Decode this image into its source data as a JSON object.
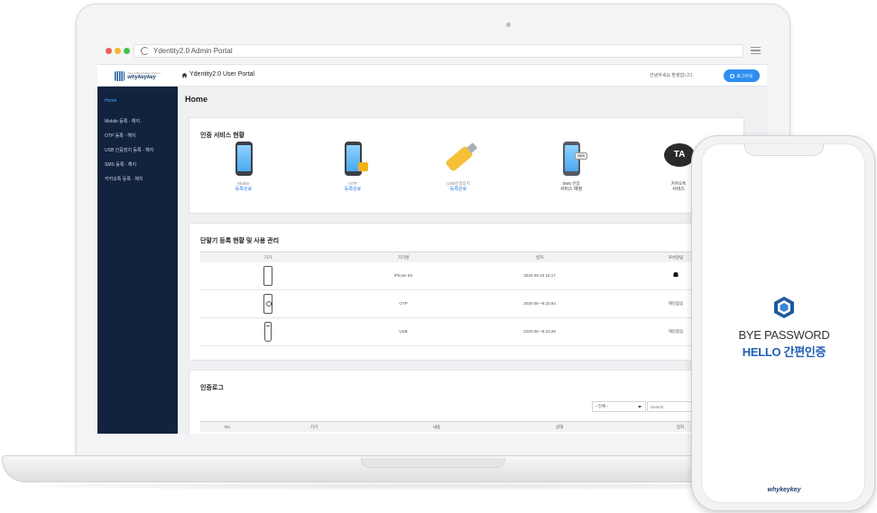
{
  "browser": {
    "address": "Ydentity2.0 Admin Portal"
  },
  "header": {
    "logo_sub": "Your Authentication Partner",
    "logo_main": "whykeykey",
    "title": "Ydentity2.0 User Portal",
    "welcome": "안녕하세요 환영합니다.",
    "logout_label": "로그아웃"
  },
  "sidebar": {
    "items": [
      {
        "label": "Home"
      },
      {
        "label": "Mobile 등록 · 해지"
      },
      {
        "label": "OTP 등록 · 해지"
      },
      {
        "label": "USB 인증장치 등록 · 해지"
      },
      {
        "label": "SMS 등록 · 해지"
      },
      {
        "label": "카카오톡 등록 · 해지"
      }
    ]
  },
  "main": {
    "page_title": "Home",
    "services": {
      "title": "인증 서비스 현황",
      "items": [
        {
          "label": "Mobile",
          "status": "등록완료",
          "icon": "mobile-phone-icon"
        },
        {
          "label": "OTP",
          "status": "등록완료",
          "icon": "otp-phone-lock-icon"
        },
        {
          "label": "USB인증장치",
          "status": "등록완료",
          "icon": "usb-key-icon"
        },
        {
          "label": "SMS 인증",
          "status": "서비스 예정",
          "icon": "sms-phone-icon"
        },
        {
          "label": "카카오톡",
          "status": "서비스",
          "icon": "kakaotalk-icon",
          "badge": "TA"
        }
      ]
    },
    "devices": {
      "title": "단말기 등록 현황 및 사용 관리",
      "columns": [
        "기기",
        "기기명",
        "일자",
        "푸쉬알림"
      ],
      "rows": [
        {
          "icon": "smartphone-device-icon",
          "name": "iPhone 6S",
          "date": "2020-06-23 18:17",
          "push": ""
        },
        {
          "icon": "otp-device-icon",
          "name": "OTP",
          "date": "2020-06-~8:15:84",
          "push": "해당없음"
        },
        {
          "icon": "usb-device-icon",
          "name": "USB",
          "date": "2020-06-~8:15:26",
          "push": "해당없음"
        }
      ]
    },
    "logs": {
      "title": "인증로그",
      "select_value": "--전체--",
      "search_placeholder": "Search",
      "columns": [
        "No",
        "기기",
        "내용",
        "상태",
        "일자"
      ]
    }
  },
  "mobile": {
    "line1": "BYE PASSWORD",
    "line2": "HELLO 간편인증",
    "logo": "whykeykey"
  },
  "colors": {
    "sidebar_bg": "#12233e",
    "accent_blue": "#2e8ef0",
    "brand_blue": "#1f5fb4"
  }
}
